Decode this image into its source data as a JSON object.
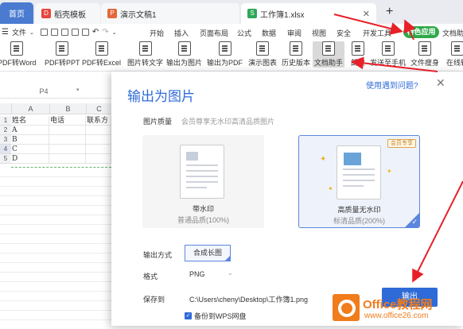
{
  "tabs": [
    {
      "label": "首页"
    },
    {
      "label": "稻壳模板",
      "icon": "docer-icon",
      "color": "#e8463c"
    },
    {
      "label": "演示文稿1",
      "icon": "presentation-icon",
      "color": "#e4683a"
    },
    {
      "label": "工作簿1.xlsx",
      "icon": "spreadsheet-icon",
      "color": "#2fa75a"
    }
  ],
  "menubar": {
    "file_label": "文件",
    "items": [
      "开始",
      "插入",
      "页面布局",
      "公式",
      "数据",
      "审阅",
      "视图",
      "安全",
      "开发工具"
    ],
    "special_label": "特色应用",
    "doc_assist_label": "文档助"
  },
  "ribbon": {
    "buttons": [
      "PDF转Word",
      "PDF转PPT",
      "PDF转Excel",
      "图片转文字",
      "输出为图片",
      "输出为PDF",
      "演示图表",
      "历史版本",
      "文档助手",
      "朗读",
      "发送至手机",
      "文件瘦身",
      "在线转"
    ]
  },
  "sheet": {
    "namebox": "P4",
    "columns": [
      "A",
      "B",
      "C"
    ],
    "rows": [
      {
        "num": "1",
        "cells": [
          "姓名",
          "电话",
          "联系方"
        ]
      },
      {
        "num": "2",
        "cells": [
          "A",
          "",
          ""
        ]
      },
      {
        "num": "3",
        "cells": [
          "B",
          "",
          ""
        ]
      },
      {
        "num": "4",
        "cells": [
          "C",
          "",
          ""
        ]
      },
      {
        "num": "5",
        "cells": [
          "D",
          "",
          ""
        ]
      }
    ]
  },
  "dialog": {
    "title": "输出为图片",
    "help_link": "使用遇到问题?",
    "quality_label": "图片质量",
    "quality_hint": "会员尊享无水印高清品质图片",
    "option_free": {
      "title": "带水印",
      "subtitle": "普通品质(100%)"
    },
    "option_hq": {
      "title": "高质量无水印",
      "subtitle": "标清品质(200%)",
      "badge": "会员专享"
    },
    "output_mode_label": "输出方式",
    "output_mode_value": "合成长图",
    "format_label": "格式",
    "format_value": "PNG",
    "save_label": "保存到",
    "save_path": "C:\\Users\\cheny\\Desktop\\工作簿1.png",
    "export_button": "输出",
    "backup_label": "备份到WPS网盘"
  },
  "watermark": {
    "title": "Office教程网",
    "url": "www.office26.com"
  },
  "colors": {
    "accent": "#2f6bd8",
    "special": "#30a84a",
    "arrow": "#e8202a"
  }
}
